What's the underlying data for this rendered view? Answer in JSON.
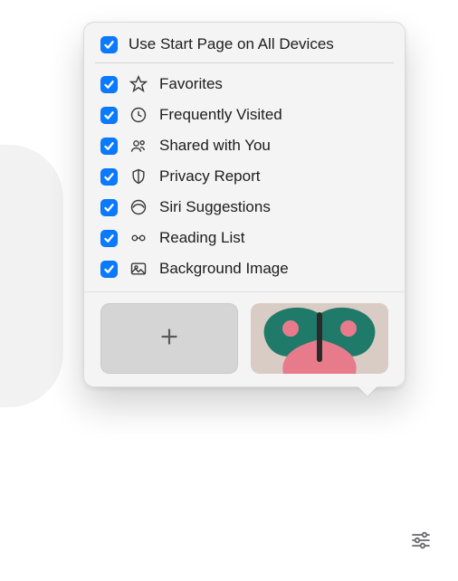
{
  "header": {
    "label": "Use Start Page on All Devices",
    "checked": true
  },
  "options": [
    {
      "icon": "star-icon",
      "label": "Favorites",
      "checked": true
    },
    {
      "icon": "clock-icon",
      "label": "Frequently Visited",
      "checked": true
    },
    {
      "icon": "people-icon",
      "label": "Shared with You",
      "checked": true
    },
    {
      "icon": "shield-icon",
      "label": "Privacy Report",
      "checked": true
    },
    {
      "icon": "siri-icon",
      "label": "Siri Suggestions",
      "checked": true
    },
    {
      "icon": "glasses-icon",
      "label": "Reading List",
      "checked": true
    },
    {
      "icon": "photo-icon",
      "label": "Background Image",
      "checked": true
    }
  ],
  "thumbnails": {
    "add_action": "add-background",
    "selected_image": "butterfly-wallpaper"
  },
  "settings_button": "start-page-settings"
}
